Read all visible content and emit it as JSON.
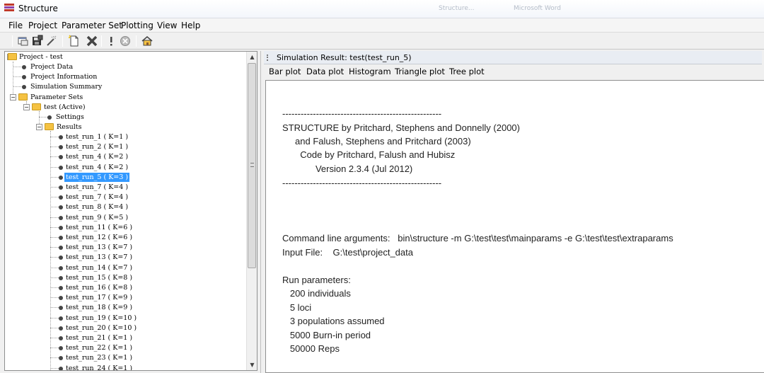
{
  "window": {
    "title": "Structure",
    "ghost_titles": [
      "Structure...",
      "Microsoft Word"
    ]
  },
  "menu": [
    "File",
    "Project",
    "Parameter Set",
    "Plotting",
    "View",
    "Help"
  ],
  "toolbar_icons": [
    "window-icon",
    "save-icon",
    "wand-icon",
    "new-document-icon",
    "delete-icon",
    "run-icon",
    "stop-icon",
    "home-icon"
  ],
  "tree": {
    "root": "Project - test",
    "project_items": [
      "Project Data",
      "Project Information",
      "Simulation Summary"
    ],
    "parameter_sets": "Parameter Sets",
    "active_set": "test (Active)",
    "settings": "Settings",
    "results": "Results",
    "runs": [
      "test_run_1 ( K=1 )",
      "test_run_2 ( K=1 )",
      "test_run_4 ( K=2 )",
      "test_run_4 ( K=2 )",
      "test_run_5 ( K=3 )",
      "test_run_7 ( K=4 )",
      "test_run_7 ( K=4 )",
      "test_run_8 ( K=4 )",
      "test_run_9 ( K=5 )",
      "test_run_11 ( K=6 )",
      "test_run_12 ( K=6 )",
      "test_run_13 ( K=7 )",
      "test_run_13 ( K=7 )",
      "test_run_14 ( K=7 )",
      "test_run_15 ( K=8 )",
      "test_run_16 ( K=8 )",
      "test_run_17 ( K=9 )",
      "test_run_18 ( K=9 )",
      "test_run_19 ( K=10 )",
      "test_run_20 ( K=10 )",
      "test_run_21 ( K=1 )",
      "test_run_22 ( K=1 )",
      "test_run_23 ( K=1 )",
      "test_run_24 ( K=1 )"
    ],
    "selected_index": 4
  },
  "result": {
    "title": "Simulation Result: test(test_run_5)",
    "plot_tabs": [
      "Bar plot",
      "Data plot",
      "Histogram",
      "Triangle plot",
      "Tree plot"
    ],
    "lines": [
      "----------------------------------------------------",
      "STRUCTURE by Pritchard, Stephens and Donnelly (2000)",
      "     and Falush, Stephens and Pritchard (2003)",
      "       Code by Pritchard, Falush and Hubisz",
      "             Version 2.3.4 (Jul 2012)",
      "----------------------------------------------------",
      "Command line arguments:   bin\\structure -m G:\\test\\test\\mainparams -e G:\\test\\test\\extraparams",
      "Input File:    G:\\test\\project_data",
      "Run parameters:",
      "   200 individuals",
      "   5 loci",
      "   3 populations assumed",
      "   5000 Burn-in period",
      "   50000 Reps"
    ]
  },
  "colors": {
    "selection": "#3399ff",
    "folder": "#f5c242",
    "delete": "#444444"
  }
}
